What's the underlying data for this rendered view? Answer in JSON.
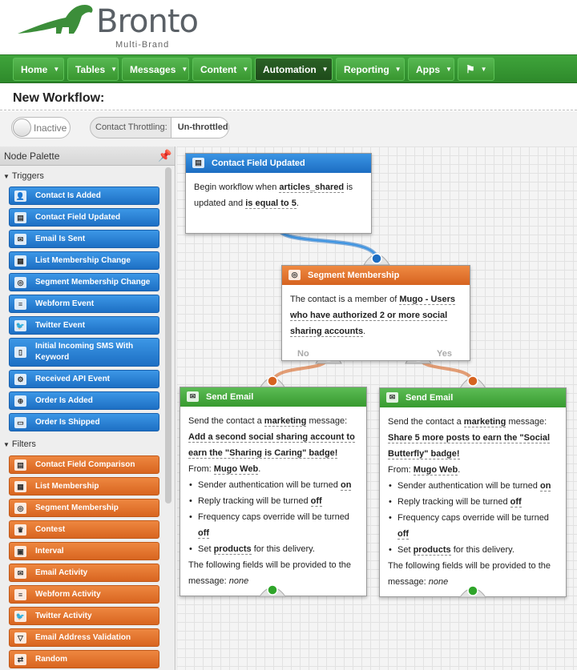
{
  "brand": {
    "name": "Bronto",
    "sub": "Multi-Brand"
  },
  "nav": [
    {
      "label": "Home"
    },
    {
      "label": "Tables"
    },
    {
      "label": "Messages"
    },
    {
      "label": "Content"
    },
    {
      "label": "Automation"
    },
    {
      "label": "Reporting"
    },
    {
      "label": "Apps"
    }
  ],
  "page": {
    "title": "New Workflow:"
  },
  "controls": {
    "status": "Inactive",
    "throttle_label": "Contact Throttling:",
    "throttle_value": "Un-throttled"
  },
  "palette": {
    "title": "Node Palette",
    "triggers_title": "Triggers",
    "filters_title": "Filters",
    "triggers": [
      {
        "label": "Contact Is Added",
        "icon": "user-icon"
      },
      {
        "label": "Contact Field Updated",
        "icon": "contact-card-icon"
      },
      {
        "label": "Email Is Sent",
        "icon": "envelope-icon"
      },
      {
        "label": "List Membership Change",
        "icon": "clipboard-icon"
      },
      {
        "label": "Segment Membership Change",
        "icon": "target-icon"
      },
      {
        "label": "Webform Event",
        "icon": "form-icon"
      },
      {
        "label": "Twitter Event",
        "icon": "bird-icon"
      },
      {
        "label": "Initial Incoming SMS With Keyword",
        "icon": "phone-icon"
      },
      {
        "label": "Received API Event",
        "icon": "gears-icon"
      },
      {
        "label": "Order Is Added",
        "icon": "cart-add-icon"
      },
      {
        "label": "Order Is Shipped",
        "icon": "truck-icon"
      }
    ],
    "filters": [
      {
        "label": "Contact Field Comparison",
        "icon": "contact-card-icon"
      },
      {
        "label": "List Membership",
        "icon": "clipboard-icon"
      },
      {
        "label": "Segment Membership",
        "icon": "target-icon"
      },
      {
        "label": "Contest",
        "icon": "trophy-icon"
      },
      {
        "label": "Interval",
        "icon": "calendar-icon"
      },
      {
        "label": "Email Activity",
        "icon": "envelope-icon"
      },
      {
        "label": "Webform Activity",
        "icon": "form-icon"
      },
      {
        "label": "Twitter Activity",
        "icon": "bird-icon"
      },
      {
        "label": "Email Address Validation",
        "icon": "funnel-icon"
      },
      {
        "label": "Random",
        "icon": "shuffle-icon"
      }
    ]
  },
  "workflow": {
    "trigger": {
      "title": "Contact Field Updated",
      "pre": "Begin workflow when",
      "field": "articles_shared",
      "mid": "is updated and",
      "cond": "is equal to 5",
      "end": "."
    },
    "segment": {
      "title": "Segment Membership",
      "pre": "The contact is a member of",
      "name": "Mugo - Users who have authorized 2 or more social sharing accounts",
      "end": ".",
      "no_label": "No",
      "yes_label": "Yes"
    },
    "email_no": {
      "title": "Send Email",
      "pre": "Send the contact a",
      "type": "marketing",
      "mid": "message:",
      "message": "Add a second social sharing account to earn the \"Sharing is Caring\" badge!",
      "from_label": "From:",
      "from": "Mugo Web",
      "b1_pre": "Sender authentication will be turned",
      "b1_val": "on",
      "b2_pre": "Reply tracking will be turned",
      "b2_val": "off",
      "b3_pre": "Frequency caps override will be turned",
      "b3_val": "off",
      "b4_pre": "Set",
      "b4_val": "products",
      "b4_post": "for this delivery.",
      "fields_text": "The following fields will be provided to the message:",
      "fields_val": "none"
    },
    "email_yes": {
      "title": "Send Email",
      "pre": "Send the contact a",
      "type": "marketing",
      "mid": "message:",
      "message": "Share 5 more posts to earn the \"Social Butterfly\" badge!",
      "from_label": "From:",
      "from": "Mugo Web",
      "b1_pre": "Sender authentication will be turned",
      "b1_val": "on",
      "b2_pre": "Reply tracking will be turned",
      "b2_val": "off",
      "b3_pre": "Frequency caps override will be turned",
      "b3_val": "off",
      "b4_pre": "Set",
      "b4_val": "products",
      "b4_post": "for this delivery.",
      "fields_text": "The following fields will be provided to the message:",
      "fields_val": "none"
    }
  },
  "colors": {
    "nav_green": "#3fa43b",
    "trigger_blue": "#1c6dc2",
    "filter_orange": "#d86520",
    "action_green": "#379a2f"
  }
}
